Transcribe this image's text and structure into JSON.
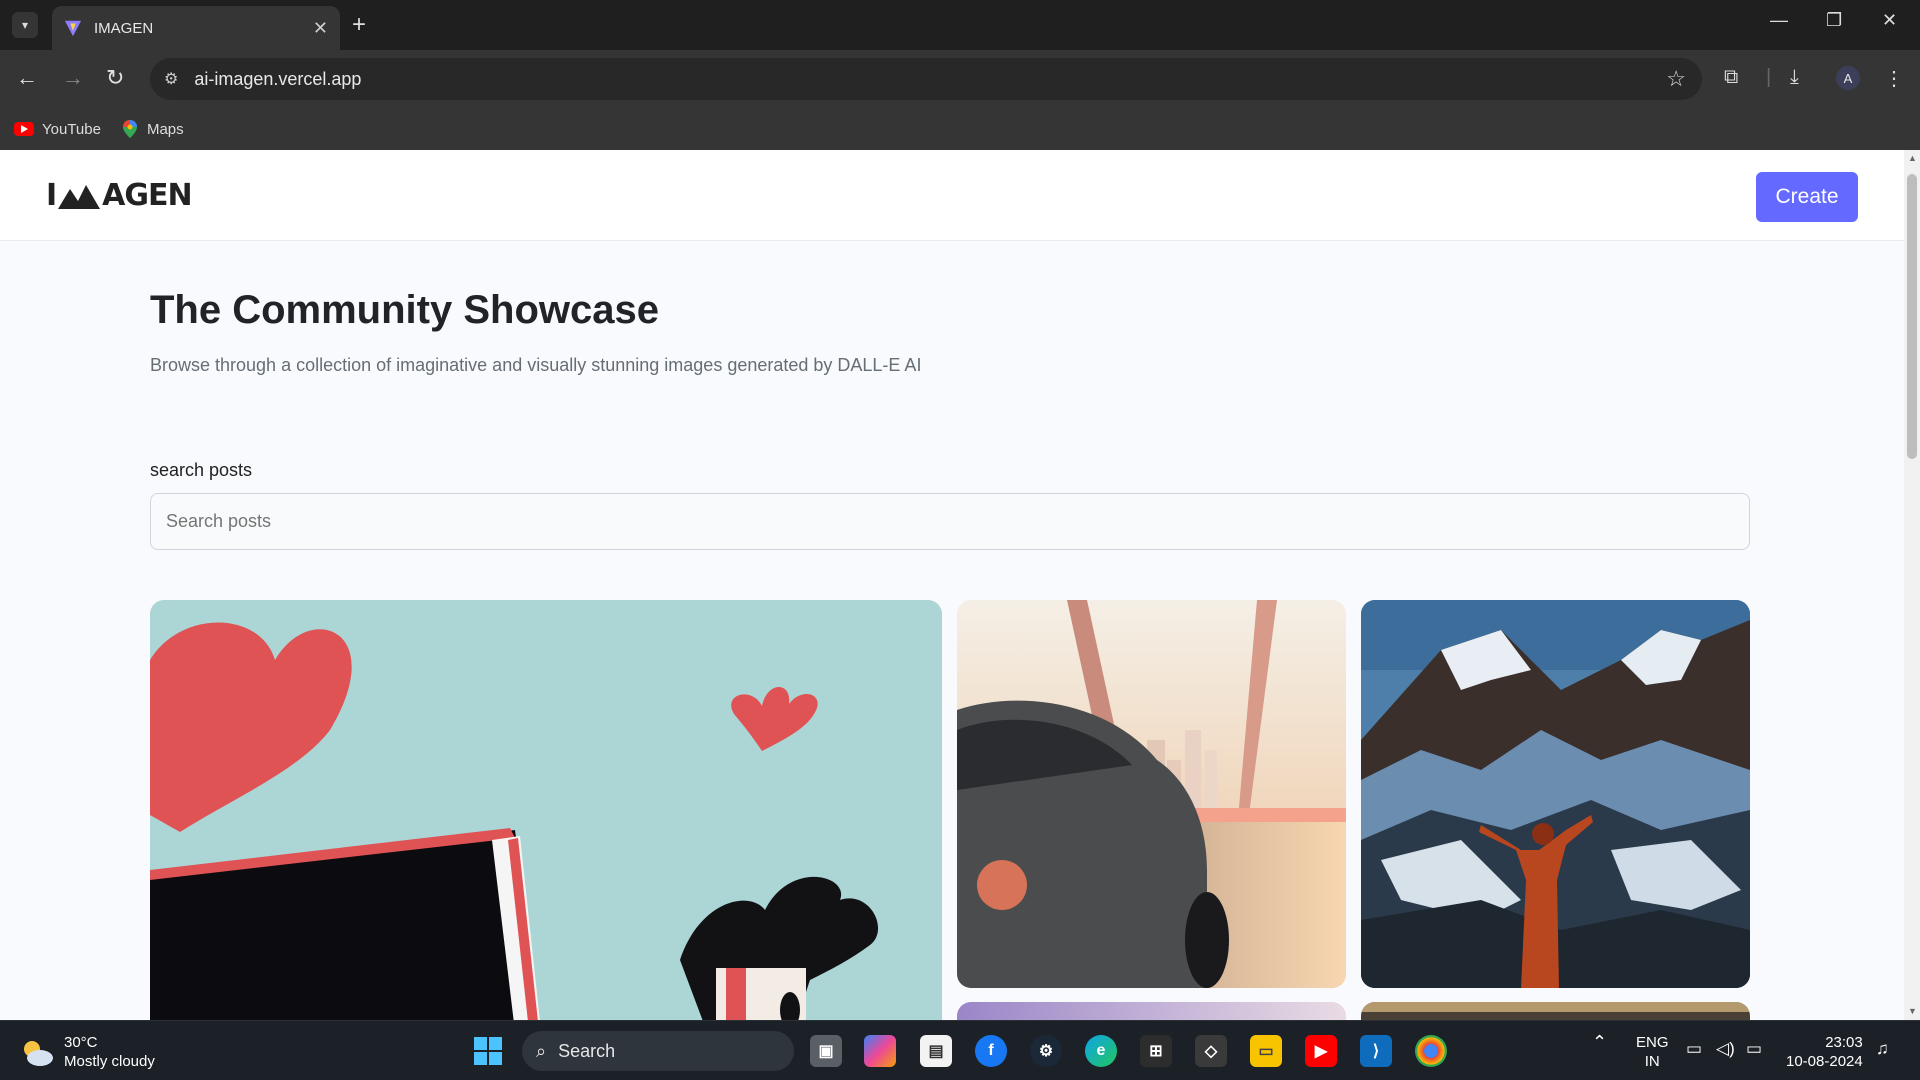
{
  "browser": {
    "tab_title": "IMAGEN",
    "url": "ai-imagen.vercel.app",
    "profile_initial": "A",
    "bookmarks": [
      {
        "label": "YouTube",
        "icon": "youtube-icon"
      },
      {
        "label": "Maps",
        "icon": "maps-icon"
      }
    ]
  },
  "header": {
    "logo_text_left": "I",
    "logo_text_right": "AGEN",
    "create_label": "Create"
  },
  "hero": {
    "title": "The Community Showcase",
    "subtitle": "Browse through a collection of imaginative and visually stunning images generated by DALL-E AI"
  },
  "search": {
    "label": "search posts",
    "placeholder": "Search posts"
  },
  "posts": [
    {
      "subject": "heart-book-boy-illustration"
    },
    {
      "subject": "car-city-sunset"
    },
    {
      "subject": "mountain-climber"
    }
  ],
  "taskbar": {
    "temperature": "30°C",
    "weather": "Mostly cloudy",
    "search_label": "Search",
    "lang_line1": "ENG",
    "lang_line2": "IN",
    "time": "23:03",
    "date": "10-08-2024"
  },
  "colors": {
    "accent": "#6469ff",
    "page_bg": "#f9fafe"
  }
}
